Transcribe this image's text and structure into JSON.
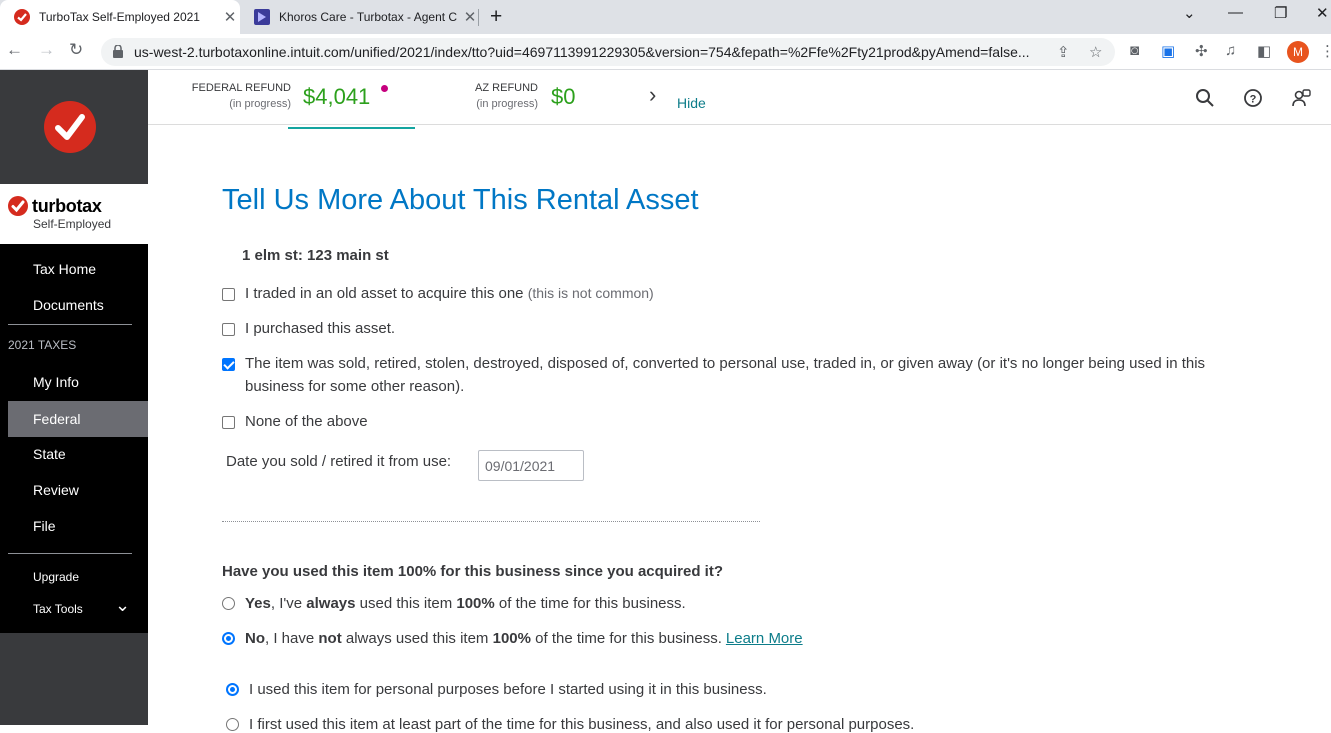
{
  "browser": {
    "tabs": [
      {
        "title": "TurboTax Self-Employed 2021",
        "close": "✕",
        "active": true
      },
      {
        "title": "Khoros Care - Turbotax - Agent C",
        "close": "✕",
        "active": false
      }
    ],
    "new_tab": "+",
    "window_controls": {
      "minimize": "⌄",
      "restore": "—",
      "maximize": "❐",
      "close": "✕"
    },
    "url": "us-west-2.turbotaxonline.intuit.com/unified/2021/index/tto?uid=4697113991229305&version=754&fepath=%2Ffe%2Fty21prod&pyAmend=false...",
    "profile_initial": "M"
  },
  "sidebar": {
    "brand_name": "turbotax",
    "brand_sub": "Self-Employed",
    "top_items": [
      "Tax Home",
      "Documents"
    ],
    "section_label": "2021 TAXES",
    "tax_items": [
      "My Info",
      "Federal",
      "State",
      "Review",
      "File"
    ],
    "selected": "Federal",
    "upgrade_label": "Upgrade",
    "tax_tools_label": "Tax Tools",
    "tax_tools_chevron": "⌄"
  },
  "refund": {
    "federal_label": "FEDERAL REFUND",
    "federal_sub": "(in progress)",
    "federal_amount": "$4,041",
    "state_label": "AZ REFUND",
    "state_sub": "(in progress)",
    "state_amount": "$0",
    "chevron": "›",
    "hide_label": "Hide",
    "accent_color": "#2ca01c"
  },
  "main": {
    "title": "Tell Us More About This Rental Asset",
    "asset_name": "1 elm st: 123 main st",
    "checkboxes": [
      {
        "label": "I traded in an old asset to acquire this one",
        "note": "(this is not common)",
        "checked": false
      },
      {
        "label": "I purchased this asset.",
        "note": "",
        "checked": false
      },
      {
        "label": "The item was sold, retired, stolen, destroyed, disposed of, converted to personal use, traded in, or given away (or it's no longer being used in this business for some other reason).",
        "note": "",
        "checked": true
      },
      {
        "label": "None of the above",
        "note": "",
        "checked": false
      }
    ],
    "date_label": "Date you sold / retired it from use:",
    "date_value": "09/01/2021",
    "question": "Have you used this item 100% for this business since you acquired it?",
    "yes_option": {
      "p1": "Yes",
      "p2": ", I've ",
      "p3": "always",
      "p4": " used this item ",
      "p5": "100%",
      "p6": " of the time for this business.",
      "selected": false
    },
    "no_option": {
      "p1": "No",
      "p2": ", I have ",
      "p3": "not",
      "p4": " always used this item ",
      "p5": "100%",
      "p6": " of the time for this business.",
      "learn_more": "Learn More",
      "selected": true
    },
    "sub_option_1": "I used this item for personal purposes before I started using it in this business.",
    "sub_option_2": "I first used this item at least part of the time for this business, and also used it for personal purposes."
  }
}
